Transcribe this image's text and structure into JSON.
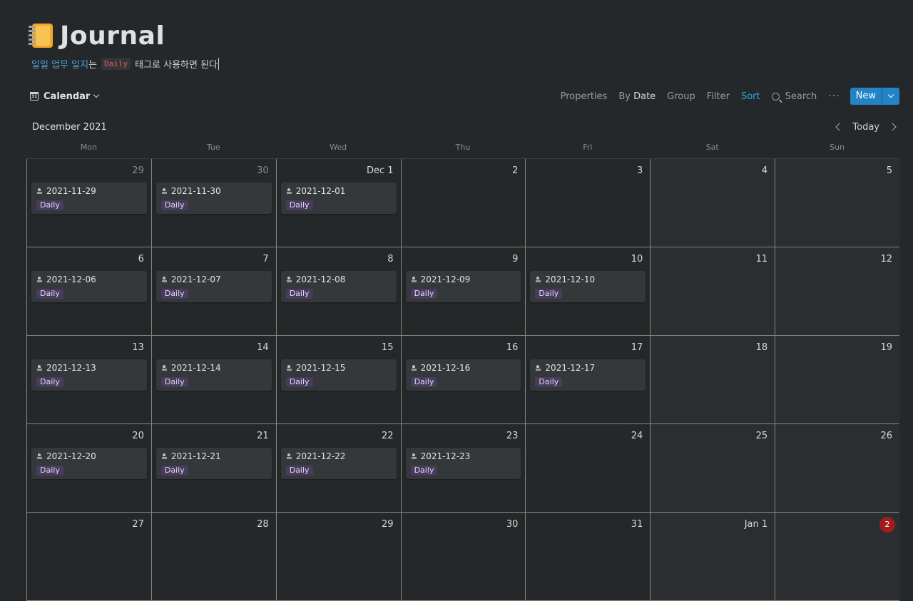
{
  "page": {
    "icon": "notebook-icon",
    "title": "Journal",
    "description": {
      "link_text": "일일 업무 일지",
      "suffix_1": "는",
      "code": "Daily",
      "suffix_2": "태그로 사용하면 된다"
    }
  },
  "toolbar": {
    "view_label": "Calendar",
    "properties": "Properties",
    "by_prefix": "By",
    "by_value": "Date",
    "group": "Group",
    "filter": "Filter",
    "sort": "Sort",
    "search": "Search",
    "more": "···",
    "new": "New"
  },
  "calendar": {
    "month": "December 2021",
    "today": "Today",
    "weekdays": [
      "Mon",
      "Tue",
      "Wed",
      "Thu",
      "Fri",
      "Sat",
      "Sun"
    ],
    "tag_label": "Daily",
    "weeks": [
      [
        {
          "day": "29",
          "muted": true,
          "entry": "2021-11-29"
        },
        {
          "day": "30",
          "muted": true,
          "entry": "2021-11-30"
        },
        {
          "day": "Dec 1",
          "entry": "2021-12-01"
        },
        {
          "day": "2"
        },
        {
          "day": "3"
        },
        {
          "day": "4",
          "weekend": true
        },
        {
          "day": "5",
          "weekend": true
        }
      ],
      [
        {
          "day": "6",
          "entry": "2021-12-06"
        },
        {
          "day": "7",
          "entry": "2021-12-07"
        },
        {
          "day": "8",
          "entry": "2021-12-08"
        },
        {
          "day": "9",
          "entry": "2021-12-09"
        },
        {
          "day": "10",
          "entry": "2021-12-10"
        },
        {
          "day": "11",
          "weekend": true
        },
        {
          "day": "12",
          "weekend": true
        }
      ],
      [
        {
          "day": "13",
          "entry": "2021-12-13"
        },
        {
          "day": "14",
          "entry": "2021-12-14"
        },
        {
          "day": "15",
          "entry": "2021-12-15"
        },
        {
          "day": "16",
          "entry": "2021-12-16"
        },
        {
          "day": "17",
          "entry": "2021-12-17"
        },
        {
          "day": "18",
          "weekend": true
        },
        {
          "day": "19",
          "weekend": true
        }
      ],
      [
        {
          "day": "20",
          "entry": "2021-12-20"
        },
        {
          "day": "21",
          "entry": "2021-12-21"
        },
        {
          "day": "22",
          "entry": "2021-12-22"
        },
        {
          "day": "23",
          "entry": "2021-12-23"
        },
        {
          "day": "24"
        },
        {
          "day": "25",
          "weekend": true
        },
        {
          "day": "26",
          "weekend": true
        }
      ],
      [
        {
          "day": "27"
        },
        {
          "day": "28"
        },
        {
          "day": "29"
        },
        {
          "day": "30"
        },
        {
          "day": "31"
        },
        {
          "day": "Jan 1",
          "weekend": true
        },
        {
          "day": "2",
          "weekend": true,
          "today": true
        }
      ]
    ]
  }
}
